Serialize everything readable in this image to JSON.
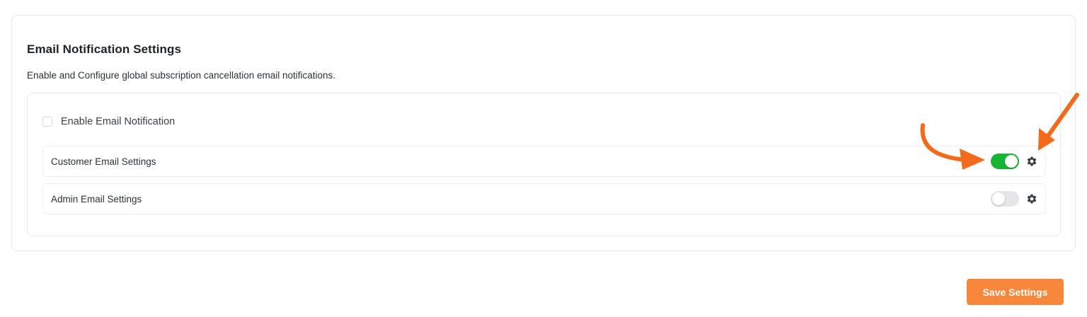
{
  "section": {
    "title": "Email Notification Settings",
    "description": "Enable and Configure global subscription cancellation email notifications."
  },
  "enable_notification": {
    "label": "Enable Email Notification",
    "checked": false
  },
  "settings": [
    {
      "label": "Customer Email Settings",
      "enabled": true,
      "icon": "gear-icon"
    },
    {
      "label": "Admin Email Settings",
      "enabled": false,
      "icon": "gear-icon"
    }
  ],
  "save_button": {
    "label": "Save Settings"
  },
  "colors": {
    "toggle_on": "#18b535",
    "toggle_off": "#e4e6ea",
    "save_button": "#f7883b",
    "annotation_arrow": "#f26a1b"
  }
}
